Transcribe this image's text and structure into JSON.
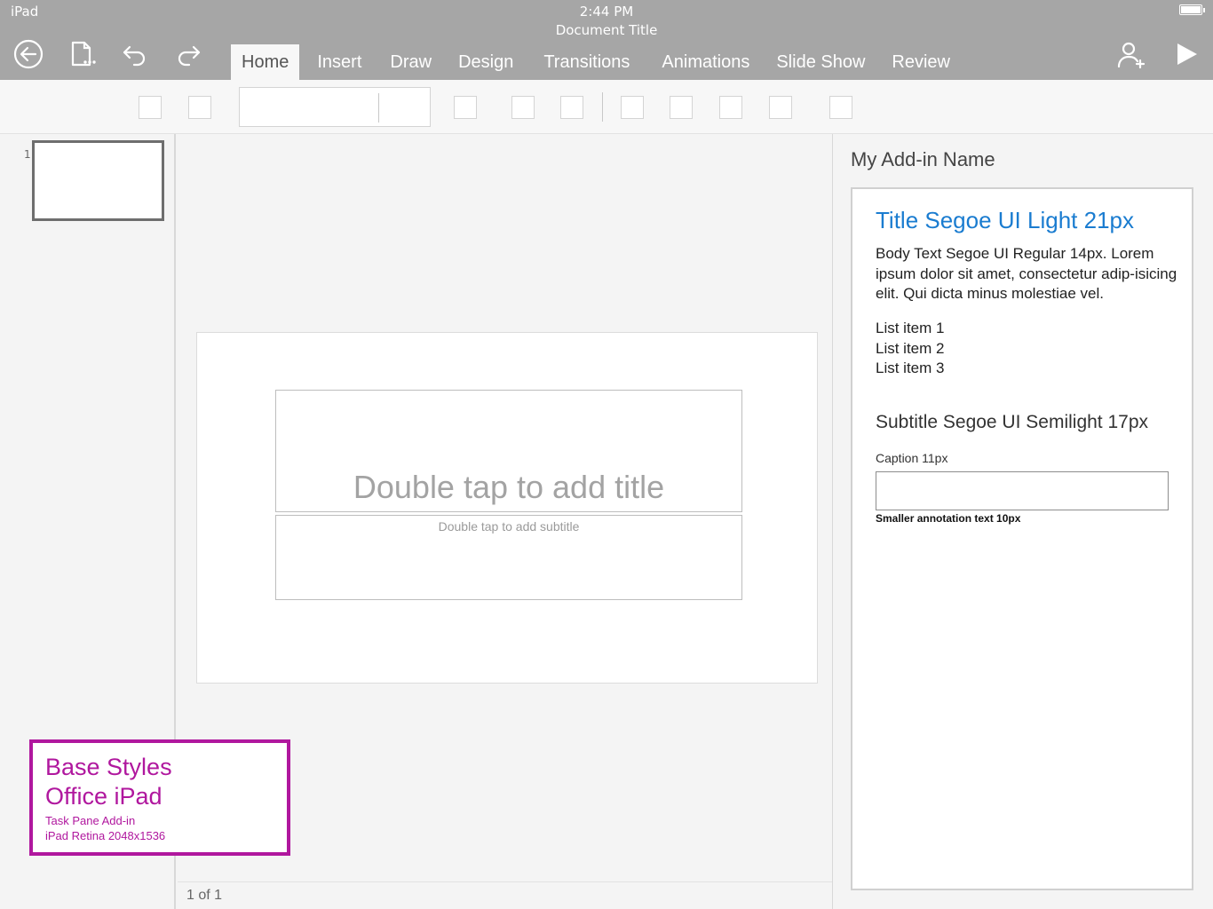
{
  "status_bar": {
    "device": "iPad",
    "time": "2:44 PM",
    "document_title": "Document Title"
  },
  "toolbar": {
    "back_icon": "back-arrow-circle-icon",
    "file_icon": "file-menu-icon",
    "undo_icon": "undo-icon",
    "redo_icon": "redo-icon",
    "share_icon": "add-person-icon",
    "present_icon": "play-icon"
  },
  "tabs": [
    {
      "label": "Home",
      "active": true
    },
    {
      "label": "Insert",
      "active": false
    },
    {
      "label": "Draw",
      "active": false
    },
    {
      "label": "Design",
      "active": false
    },
    {
      "label": "Transitions",
      "active": false
    },
    {
      "label": "Animations",
      "active": false
    },
    {
      "label": "Slide Show",
      "active": false
    },
    {
      "label": "Review",
      "active": false
    }
  ],
  "thumbnails": [
    {
      "number": "1"
    }
  ],
  "slide": {
    "title_placeholder": "Double tap to add title",
    "subtitle_placeholder": "Double tap to add subtitle"
  },
  "status": {
    "page_indicator": "1 of 1"
  },
  "task_pane": {
    "header": "My Add-in Name",
    "title": "Title Segoe UI Light 21px",
    "body": "Body Text Segoe UI Regular 14px. Lorem ipsum dolor sit amet, consectetur adip-isicing elit. Qui dicta minus molestiae vel.",
    "list": [
      "List item 1",
      "List item 2",
      "List item 3"
    ],
    "subtitle": "Subtitle Segoe UI Semilight 17px",
    "caption": "Caption 11px",
    "input_value": "",
    "annotation": "Smaller annotation text 10px"
  },
  "label": {
    "line1": "Base Styles",
    "line2": "Office iPad",
    "line3": "Task Pane Add-in",
    "line4": "iPad Retina 2048x1536"
  },
  "colors": {
    "chrome": "#a6a6a6",
    "accent_title": "#1a7cd0",
    "label_magenta": "#b0179e"
  }
}
